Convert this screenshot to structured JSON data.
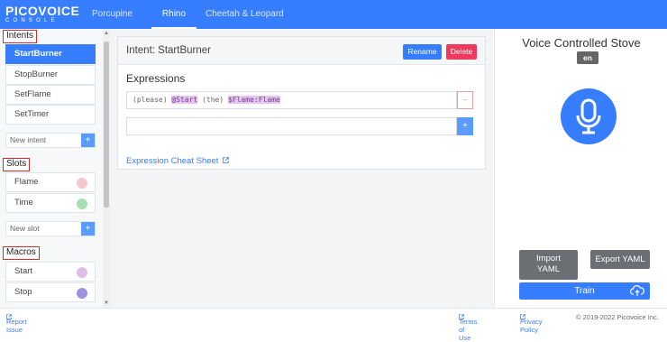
{
  "header": {
    "logo_main": "PICOVOICE",
    "logo_sub": "CONSOLE",
    "tabs": [
      {
        "label": "Porcupine",
        "active": false
      },
      {
        "label": "Rhino",
        "active": true
      },
      {
        "label": "Cheetah & Leopard",
        "active": false
      }
    ]
  },
  "sidebar": {
    "intents_title": "Intents",
    "intents": [
      "StartBurner",
      "StopBurner",
      "SetFlame",
      "SetTimer"
    ],
    "intents_active": "StartBurner",
    "new_intent_placeholder": "New intent",
    "slots_title": "Slots",
    "slots": [
      {
        "label": "Flame",
        "color": "#f7c6d3"
      },
      {
        "label": "Time",
        "color": "#a8dfb1"
      }
    ],
    "new_slot_placeholder": "New slot",
    "macros_title": "Macros",
    "macros": [
      {
        "label": "Start",
        "color": "#dcc0ea"
      },
      {
        "label": "Stop",
        "color": "#9d92e0"
      }
    ]
  },
  "intent_panel": {
    "title": "Intent: StartBurner",
    "rename_label": "Rename",
    "delete_label": "Delete",
    "expressions_label": "Expressions",
    "expression": {
      "part1": "(please) ",
      "macro": "@Start",
      "part2": " (the) ",
      "slot": "$Flame:Flame"
    },
    "remove_label": "–",
    "add_label": "+",
    "cheat_sheet_label": "Expression Cheat Sheet"
  },
  "context_panel": {
    "title": "Voice Controlled Stove",
    "language": "en",
    "import_label_line1": "Import",
    "import_label_line2": "YAML",
    "export_label": "Export YAML",
    "train_label": "Train"
  },
  "footer": {
    "report_issue": "Report Issue",
    "terms": "Terms of Use",
    "privacy": "Privacy Policy",
    "copyright": "© 2019-2022 Picovoice Inc."
  },
  "colors": {
    "brand": "#377dff",
    "delete": "#ef3a5d",
    "highlight_box": "#d32f2f"
  }
}
